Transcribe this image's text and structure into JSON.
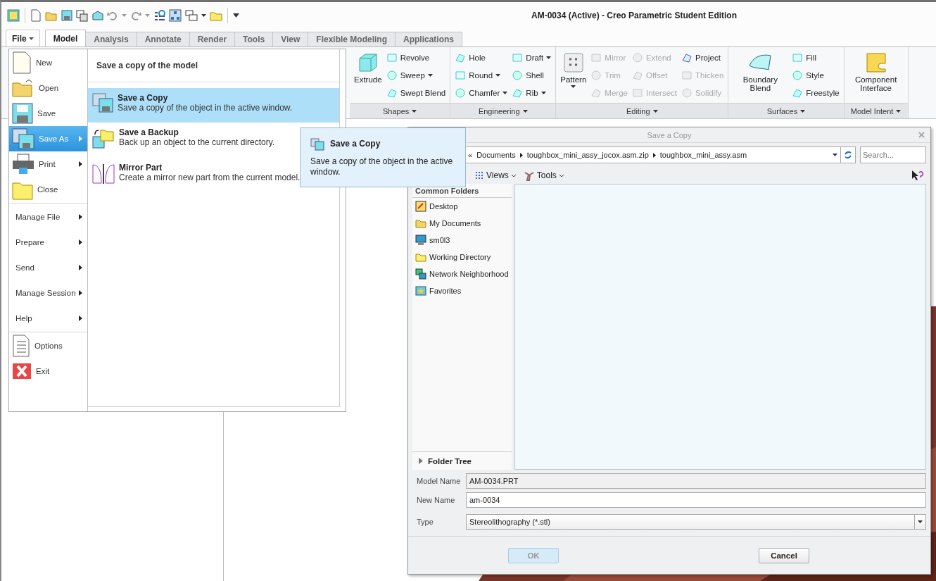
{
  "window": {
    "title": "AM-0034 (Active) - Creo Parametric Student Edition"
  },
  "file_button": {
    "label": "File",
    "open": true
  },
  "tabs": [
    {
      "label": "Model",
      "selected": true
    },
    {
      "label": "Analysis",
      "selected": false
    },
    {
      "label": "Annotate",
      "selected": false
    },
    {
      "label": "Render",
      "selected": false
    },
    {
      "label": "Tools",
      "selected": false
    },
    {
      "label": "View",
      "selected": false
    },
    {
      "label": "Flexible Modeling",
      "selected": false
    },
    {
      "label": "Applications",
      "selected": false
    }
  ],
  "ribbon": {
    "groups": [
      {
        "label": "Shapes",
        "columns": [
          [
            {
              "label": "Extrude",
              "kind": "large",
              "disabled": false,
              "dropdown": false
            }
          ],
          [
            {
              "label": "Revolve",
              "kind": "small",
              "disabled": false,
              "dropdown": false
            },
            {
              "label": "Sweep",
              "kind": "small",
              "disabled": false,
              "dropdown": true
            },
            {
              "label": "Swept Blend",
              "kind": "small",
              "disabled": false,
              "dropdown": false
            }
          ]
        ]
      },
      {
        "label": "Engineering",
        "columns": [
          [
            {
              "label": "Hole",
              "kind": "small",
              "disabled": false,
              "dropdown": false
            },
            {
              "label": "Round",
              "kind": "small",
              "disabled": false,
              "dropdown": true
            },
            {
              "label": "Chamfer",
              "kind": "small",
              "disabled": false,
              "dropdown": true
            }
          ],
          [
            {
              "label": "Draft",
              "kind": "small",
              "disabled": false,
              "dropdown": true
            },
            {
              "label": "Shell",
              "kind": "small",
              "disabled": false,
              "dropdown": false
            },
            {
              "label": "Rib",
              "kind": "small",
              "disabled": false,
              "dropdown": true
            }
          ]
        ]
      },
      {
        "label": "Editing",
        "columns": [
          [
            {
              "label": "Pattern",
              "kind": "large",
              "disabled": false,
              "dropdown": true
            }
          ],
          [
            {
              "label": "Mirror",
              "kind": "small",
              "disabled": true,
              "dropdown": false
            },
            {
              "label": "Trim",
              "kind": "small",
              "disabled": true,
              "dropdown": false
            },
            {
              "label": "Merge",
              "kind": "small",
              "disabled": true,
              "dropdown": false
            }
          ],
          [
            {
              "label": "Extend",
              "kind": "small",
              "disabled": true,
              "dropdown": false
            },
            {
              "label": "Offset",
              "kind": "small",
              "disabled": true,
              "dropdown": false
            },
            {
              "label": "Intersect",
              "kind": "small",
              "disabled": true,
              "dropdown": false
            }
          ],
          [
            {
              "label": "Project",
              "kind": "small",
              "disabled": false,
              "dropdown": false
            },
            {
              "label": "Thicken",
              "kind": "small",
              "disabled": true,
              "dropdown": false
            },
            {
              "label": "Solidify",
              "kind": "small",
              "disabled": true,
              "dropdown": false
            }
          ]
        ]
      },
      {
        "label": "Surfaces",
        "columns": [
          [
            {
              "label": "Boundary Blend",
              "kind": "large",
              "disabled": false,
              "dropdown": false
            }
          ],
          [
            {
              "label": "Fill",
              "kind": "small",
              "disabled": false,
              "dropdown": false
            },
            {
              "label": "Style",
              "kind": "small",
              "disabled": false,
              "dropdown": false
            },
            {
              "label": "Freestyle",
              "kind": "small",
              "disabled": false,
              "dropdown": false
            }
          ]
        ]
      },
      {
        "label": "Model Intent",
        "columns": [
          [
            {
              "label": "Component Interface",
              "kind": "large",
              "disabled": false,
              "dropdown": false
            }
          ]
        ]
      }
    ]
  },
  "file_menu": {
    "sections": [
      {
        "items": [
          {
            "label": "New",
            "kind": "icon",
            "selected": false,
            "submenu": false
          },
          {
            "label": "Open",
            "kind": "icon",
            "selected": false,
            "submenu": false
          },
          {
            "label": "Save",
            "kind": "icon",
            "selected": false,
            "submenu": false
          },
          {
            "label": "Save As",
            "kind": "icon",
            "selected": true,
            "submenu": true
          },
          {
            "label": "Print",
            "kind": "icon",
            "selected": false,
            "submenu": true
          },
          {
            "label": "Close",
            "kind": "icon",
            "selected": false,
            "submenu": false
          }
        ]
      },
      {
        "items": [
          {
            "label": "Manage File",
            "kind": "text",
            "selected": false,
            "submenu": true
          },
          {
            "label": "Prepare",
            "kind": "text",
            "selected": false,
            "submenu": true
          },
          {
            "label": "Send",
            "kind": "text",
            "selected": false,
            "submenu": true
          },
          {
            "label": "Manage Session",
            "kind": "text",
            "selected": false,
            "submenu": true
          },
          {
            "label": "Help",
            "kind": "text",
            "selected": false,
            "submenu": true
          }
        ]
      },
      {
        "items": [
          {
            "label": "Options",
            "kind": "icon",
            "selected": false,
            "submenu": false
          },
          {
            "label": "Exit",
            "kind": "icon",
            "selected": false,
            "submenu": false
          }
        ]
      }
    ],
    "panel": {
      "heading": "Save a copy of the model",
      "options": [
        {
          "title": "Save a Copy",
          "description": "Save a copy of the object in the active window.",
          "selected": true
        },
        {
          "title": "Save a Backup",
          "description": "Back up an object to the current directory.",
          "selected": false
        },
        {
          "title": "Mirror Part",
          "description": "Create a mirror new part from the current model.",
          "selected": false
        }
      ]
    }
  },
  "tooltip": {
    "title": "Save a Copy",
    "text": "Save a copy of the object in the active window."
  },
  "dialog": {
    "title": "Save a Copy",
    "path_prefix": "«",
    "path": [
      "Documents",
      "toughbox_mini_assy_jocox.asm.zip",
      "toughbox_mini_assy.asm"
    ],
    "search": {
      "placeholder": "Search..."
    },
    "toolbar": [
      {
        "label": "Views"
      },
      {
        "label": "Tools"
      }
    ],
    "common_folders": {
      "heading": "Common Folders",
      "items": [
        "Desktop",
        "My Documents",
        "sm0l3",
        "Working Directory",
        "Network Neighborhood",
        "Favorites"
      ]
    },
    "folder_tree": {
      "label": "Folder Tree",
      "expanded": false
    },
    "fields": [
      {
        "label": "Model Name",
        "value": "AM-0034.PRT",
        "kind": "readonly"
      },
      {
        "label": "New Name",
        "value": "am-0034",
        "kind": "text"
      },
      {
        "label": "Type",
        "value": "Stereolithography (*.stl)",
        "kind": "select"
      }
    ],
    "buttons": [
      {
        "label": "OK",
        "disabled": true
      },
      {
        "label": "Cancel",
        "disabled": false
      }
    ]
  }
}
